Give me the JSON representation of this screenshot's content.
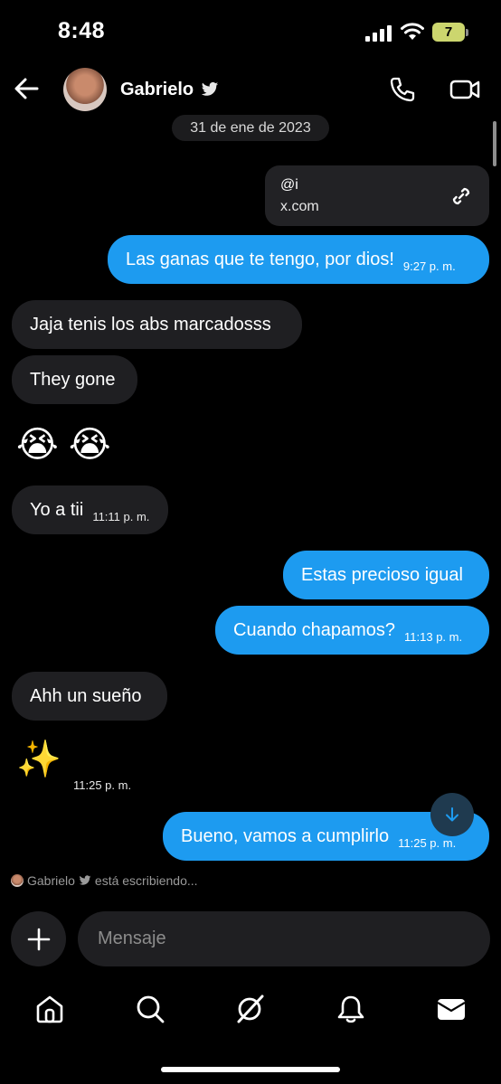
{
  "status_bar": {
    "time": "8:48",
    "battery": "7"
  },
  "header": {
    "contact_name": "Gabrielo"
  },
  "date_separator": "31 de ene de 2023",
  "link_card": {
    "handle": "@i",
    "domain": "x.com"
  },
  "messages": [
    {
      "text": "Las ganas que te tengo, por dios!",
      "time": "9:27 p. m."
    },
    {
      "text": "Jaja tenis los abs marcadosss"
    },
    {
      "text": "They gone"
    },
    {
      "emoji": "😭 😭"
    },
    {
      "text": "Yo a tii",
      "time": "11:11 p. m."
    },
    {
      "text": "Estas precioso igual"
    },
    {
      "text": "Cuando chapamos?",
      "time": "11:13 p. m."
    },
    {
      "text": "Ahh un sueño"
    },
    {
      "emoji": "✨",
      "time": "11:25 p. m."
    },
    {
      "text": "Bueno, vamos a cumplirlo",
      "time": "11:25 p. m."
    }
  ],
  "typing_indicator": {
    "name": "Gabrielo",
    "text": "está escribiendo..."
  },
  "composer": {
    "placeholder": "Mensaje"
  },
  "colors": {
    "outgoing_bubble": "#1d9bf0",
    "incoming_bubble": "#1f1f22",
    "background": "#000000"
  },
  "nav": [
    "home-icon",
    "search-icon",
    "grok-icon",
    "notifications-icon",
    "messages-icon"
  ]
}
